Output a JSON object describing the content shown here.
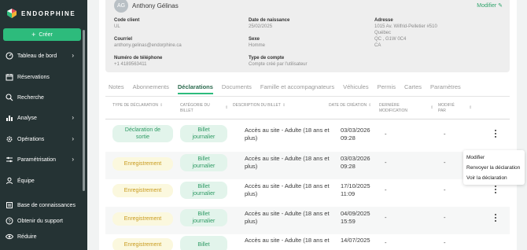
{
  "brand": {
    "name": "ENDORPHINE",
    "colors": {
      "sidebar": "#253334",
      "accent": "#2dbb7c",
      "active_tab": "#2c6a4e"
    }
  },
  "sidebar": {
    "create_label": "Créer",
    "items": [
      {
        "label": "Tableau de bord",
        "icon": "dashboard-icon",
        "chevron": true
      },
      {
        "label": "Réservations",
        "icon": "calendar-icon",
        "chevron": false
      },
      {
        "label": "Recherche",
        "icon": "search-icon",
        "chevron": false
      },
      {
        "label": "Analyse",
        "icon": "chart-icon",
        "chevron": true
      },
      {
        "label": "Opérations",
        "icon": "settings-gear-icon",
        "chevron": true
      },
      {
        "label": "Paramétrisation",
        "icon": "sliders-icon",
        "chevron": true
      },
      {
        "label": "Équipe",
        "icon": "team-icon",
        "chevron": false
      },
      {
        "label": "Base de connaissances",
        "icon": "book-icon",
        "chevron": false
      },
      {
        "label": "Obtenir du support",
        "icon": "help-icon",
        "chevron": false
      },
      {
        "label": "Réduire",
        "icon": "eye-icon",
        "chevron": false
      }
    ]
  },
  "profile": {
    "initials": "AG",
    "name": "Anthony Gélinas",
    "modify_label": "Modifier",
    "fields": {
      "client_code": {
        "label": "Code client",
        "value": "UL"
      },
      "birth_date": {
        "label": "Date de naissance",
        "value": "25/02/2025"
      },
      "address": {
        "label": "Adresse",
        "line1": "1015 Av. Wilfrid-Pelletier #510",
        "line2": "Québec",
        "line3": "QC , G1W 0C4",
        "line4": "CA"
      },
      "email": {
        "label": "Courriel",
        "value": "anthony.gelinas@endorphine.ca"
      },
      "sex": {
        "label": "Sexe",
        "value": "Homme"
      },
      "phone": {
        "label": "Numéro de téléphone",
        "value": "+1 4189563411"
      },
      "account_type": {
        "label": "Type de compte",
        "value": "Compte créé par l'utilisateur"
      }
    }
  },
  "tabs": [
    {
      "label": "Notes",
      "active": false
    },
    {
      "label": "Abonnements",
      "active": false
    },
    {
      "label": "Déclarations",
      "active": true
    },
    {
      "label": "Documents",
      "active": false
    },
    {
      "label": "Famille et accompagnateurs",
      "active": false
    },
    {
      "label": "Véhicules",
      "active": false
    },
    {
      "label": "Permis",
      "active": false
    },
    {
      "label": "Cartes",
      "active": false
    },
    {
      "label": "Paramètres",
      "active": false
    }
  ],
  "table": {
    "headers": {
      "type": "TYPE DE DÉCLARATION",
      "category_1": "CATÉGORIE DU",
      "category_2": "BILLET",
      "description": "DESCRIPTION DU BILLET",
      "created": "DATE DE CRÉATION",
      "last_mod_1": "DERNIÈRE",
      "last_mod_2": "MODIFICATION",
      "mod_by_1": "MODIFIÉ",
      "mod_by_2": "PAR"
    },
    "rows": [
      {
        "type_1": "Déclaration de",
        "type_2": "sortie",
        "type_style": "green",
        "cat_1": "Billet",
        "cat_2": "journalier",
        "desc_1": "Accès au site - Adulte (18 ans et",
        "desc_2": "plus)",
        "date_1": "03/03/2026",
        "date_2": "09:28",
        "last_mod": "-",
        "mod_by": "-"
      },
      {
        "type_1": "Enregistrement",
        "type_2": "",
        "type_style": "yellow",
        "cat_1": "Billet",
        "cat_2": "journalier",
        "desc_1": "Accès au site - Adulte (18 ans et",
        "desc_2": "plus)",
        "date_1": "03/03/2026",
        "date_2": "09:28",
        "last_mod": "-",
        "mod_by": "-"
      },
      {
        "type_1": "Enregistrement",
        "type_2": "",
        "type_style": "yellow",
        "cat_1": "Billet",
        "cat_2": "journalier",
        "desc_1": "Accès au site - Adulte (18 ans et",
        "desc_2": "plus)",
        "date_1": "17/10/2025",
        "date_2": "11:09",
        "last_mod": "-",
        "mod_by": "-"
      },
      {
        "type_1": "Enregistrement",
        "type_2": "",
        "type_style": "yellow",
        "cat_1": "Billet",
        "cat_2": "journalier",
        "desc_1": "Accès au site - Adulte (18 ans et",
        "desc_2": "plus)",
        "date_1": "04/09/2025",
        "date_2": "15:59",
        "last_mod": "-",
        "mod_by": "-"
      },
      {
        "type_1": "Enregistrement",
        "type_2": "",
        "type_style": "yellow",
        "cat_1": "Billet",
        "cat_2": "",
        "desc_1": "Accès au site - Adulte (18 ans et",
        "desc_2": "",
        "date_1": "14/07/2025",
        "date_2": "",
        "last_mod": "-",
        "mod_by": "-"
      }
    ]
  },
  "row_menu": {
    "items": [
      "Modifier",
      "Renvoyer la déclaration",
      "Voir la déclaration"
    ]
  }
}
